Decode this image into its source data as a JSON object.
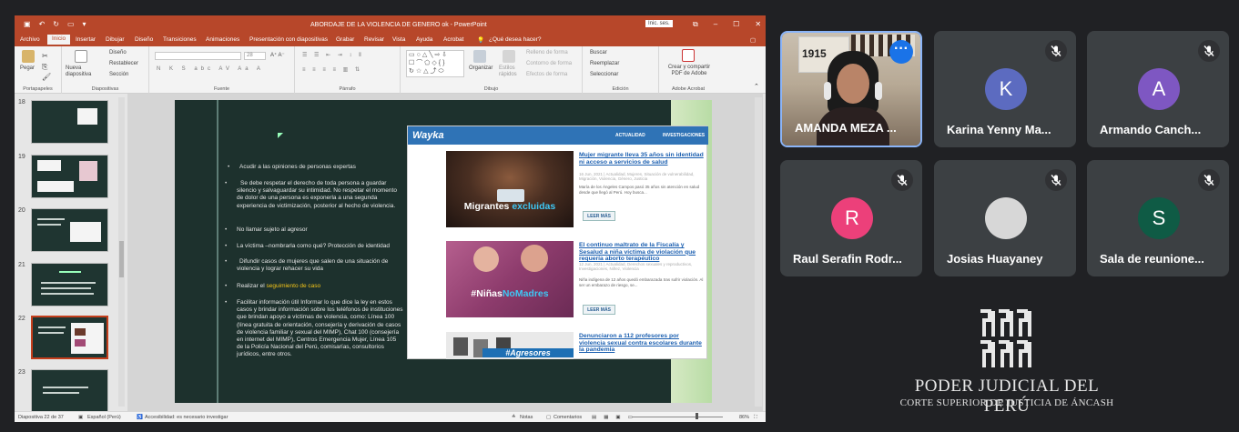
{
  "powerpoint": {
    "document_title": "ABORDAJE DE LA VIOLENCIA DE GENERO ok  -  PowerPoint",
    "signin": "Inic. ses.",
    "tabs": [
      "Archivo",
      "Inicio",
      "Insertar",
      "Dibujar",
      "Diseño",
      "Transiciones",
      "Animaciones",
      "Presentación con diapositivas",
      "Grabar",
      "Revisar",
      "Vista",
      "Ayuda",
      "Acrobat"
    ],
    "tell_me": "¿Qué desea hacer?",
    "ribbon": {
      "groups": [
        "Portapapeles",
        "Diapositivas",
        "Fuente",
        "Párrafo",
        "Dibujo",
        "Edición",
        "Adobe Acrobat"
      ],
      "paste": "Pegar",
      "new_slide": "Nueva diapositiva",
      "layout": "Diseño",
      "reset": "Restablecer",
      "section": "Sección",
      "arrange": "Organizar",
      "quick_styles": "Estilos rápidos",
      "shape_fill": "Relleno de forma",
      "shape_outline": "Contorno de forma",
      "shape_effects": "Efectos de forma",
      "find": "Buscar",
      "replace": "Reemplazar",
      "select": "Seleccionar",
      "create_pdf": "Crear y compartir PDF de Adobe",
      "font_size": "28"
    },
    "thumbnails": [
      {
        "num": "18"
      },
      {
        "num": "19"
      },
      {
        "num": "20"
      },
      {
        "num": "21"
      },
      {
        "num": "22",
        "selected": true
      },
      {
        "num": "23"
      }
    ],
    "slide": {
      "bullets": [
        "Acudir a las opiniones de personas expertas",
        "Se debe respetar el derecho de toda persona a guardar silencio y salvaguardar su intimidad. No respetar el momento de dolor de una persona es exponerla a una segunda experiencia de victimización, posterior al hecho de violencia.",
        "No llamar sujeto al agresor",
        "La víctima –nombrarla como qué? Protección de identidad",
        "Difundir casos de mujeres que salen de una situación de violencia y lograr rehacer su vida",
        "Realizar el",
        "Facilitar información útil Informar lo que dice la ley en estos casos y brindar información sobre los teléfonos de instituciones que brindan apoyo a víctimas de violencia, como: Línea 100 (línea gratuita de orientación, consejería y derivación de casos de violencia familiar y sexual del MIMP), Chat 100 (consejería en internet del MIMP), Centros Emergencia Mujer, Línea 105 de la Policía Nacional del Perú, comisarías, consultorios jurídicos, entre otros."
      ],
      "highlight": "seguimiento de caso",
      "wayka": {
        "logo": "Wayka",
        "nav": [
          "ACTUALIDAD",
          "INVESTIGACIONES"
        ],
        "articles": [
          {
            "caption_a": "Migrantes",
            "caption_b": "excluidas",
            "title": "Mujer migrante lleva 35 años sin identidad ni acceso a servicios de salud",
            "meta": "16 Jun, 2021 | Actualidad, Mujeres, Situación de vulnerabilidad, Migración, Violencia, Género, Justicia",
            "desc": "María de los Ángeles Campos pasó 35 años sin atención en salud desde que llegó al Perú. Hoy busca...",
            "more": "LEER MÁS"
          },
          {
            "caption_a": "#Niñas",
            "caption_b": "NoMadres",
            "title": "El continuo maltrato de la Fiscalía y Sesalud a niña víctima de violación que requería aborto terapéutico",
            "meta": "12 Jun, 2021 | Actualidad, Derechos sexuales y reproductivos, Investigaciones, Niñez, Violencia",
            "desc": "Niña indígena de 12 años quedó embarazada tras sufrir violación. Al ser un embarazo de riesgo, se...",
            "more": "LEER MÁS"
          },
          {
            "caption_a": "#Agresores",
            "caption_b": "",
            "title": "Denunciaron a 112 profesores por violencia sexual contra escolares durante la pandemia",
            "meta": "",
            "desc": "",
            "more": ""
          }
        ]
      }
    },
    "status": {
      "slide_pos": "Diapositiva 22 de 37",
      "language": "Español (Perú)",
      "accessibility": "Accesibilidad: es necesario investigar",
      "notes": "Notas",
      "comments": "Comentarios",
      "zoom": "86%"
    }
  },
  "participants": [
    {
      "name": "AMANDA MEZA ...",
      "initial": "",
      "color": "",
      "speaking": true
    },
    {
      "name": "Karina Yenny Ma...",
      "initial": "K",
      "color": "#5c6bc0"
    },
    {
      "name": "Armando Canch...",
      "initial": "A",
      "color": "#7e57c2"
    },
    {
      "name": "Raul Serafin Rodr...",
      "initial": "R",
      "color": "#ec407a"
    },
    {
      "name": "Josias Huayaney",
      "initial": "",
      "color": "#d7d7d7"
    },
    {
      "name": "Sala de reunione...",
      "initial": "S",
      "color": "#0f5b45"
    }
  ],
  "branding": {
    "line1": "PODER JUDICIAL DEL PERÚ",
    "line2": "CORTE SUPERIOR DE JUSTICIA DE ÁNCASH"
  },
  "colors": {
    "ppt_accent": "#b7472a",
    "meet_bg": "#202124",
    "tile_bg": "#3c4043",
    "link_blue": "#1b5fb0"
  }
}
